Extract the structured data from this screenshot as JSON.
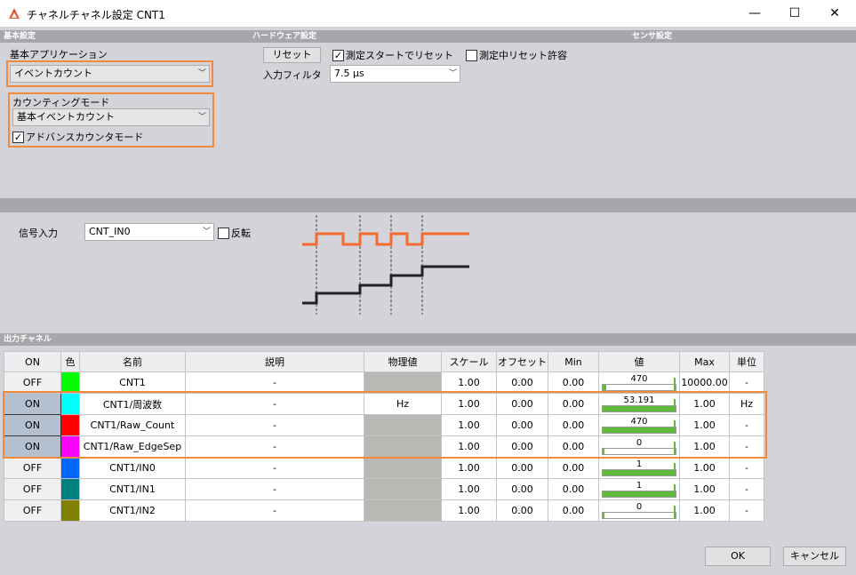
{
  "window": {
    "title": "チャネルチャネル設定 CNT1",
    "minimize": "—",
    "maximize": "☐",
    "close": "✕"
  },
  "sections": {
    "basic": "基本設定",
    "hardware": "ハードウェア設定",
    "sensor": "センサ設定",
    "output": "出力チャネル"
  },
  "basic": {
    "app_label": "基本アプリケーション",
    "app_value": "イベントカウント",
    "mode_label": "カウンティングモード",
    "mode_value": "基本イベントカウント",
    "advanced_label": "アドバンスカウンタモード",
    "advanced_checked": true
  },
  "hardware": {
    "reset_button": "リセット",
    "reset_on_start_label": "測定スタートでリセット",
    "reset_on_start_checked": true,
    "allow_reset_label": "測定中リセット許容",
    "allow_reset_checked": false,
    "filter_label": "入力フィルタ",
    "filter_value": "7.5 µs"
  },
  "signal": {
    "label": "信号入力",
    "value": "CNT_IN0",
    "invert_label": "反転",
    "invert_checked": false
  },
  "table": {
    "headers": [
      "ON",
      "色",
      "名前",
      "説明",
      "物理値",
      "スケール",
      "オフセット",
      "Min",
      "値",
      "Max",
      "単位"
    ],
    "rows": [
      {
        "on": "OFF",
        "color": "#00ff00",
        "name": "CNT1",
        "desc": "-",
        "phys": "",
        "scale": "1.00",
        "offset": "0.00",
        "min": "0.00",
        "value": "470",
        "fill": 0.05,
        "max": "10000.00",
        "unit": "-"
      },
      {
        "on": "ON",
        "color": "#00ffff",
        "name": "CNT1/周波数",
        "desc": "-",
        "phys": "Hz",
        "scale": "1.00",
        "offset": "0.00",
        "min": "0.00",
        "value": "53.191",
        "fill": 1.0,
        "max": "1.00",
        "unit": "Hz"
      },
      {
        "on": "ON",
        "color": "#ff0000",
        "name": "CNT1/Raw_Count",
        "desc": "-",
        "phys": "",
        "scale": "1.00",
        "offset": "0.00",
        "min": "0.00",
        "value": "470",
        "fill": 1.0,
        "max": "1.00",
        "unit": "-"
      },
      {
        "on": "ON",
        "color": "#ff00ff",
        "name": "CNT1/Raw_EdgeSep",
        "desc": "-",
        "phys": "",
        "scale": "1.00",
        "offset": "0.00",
        "min": "0.00",
        "value": "0",
        "fill": 0.0,
        "max": "1.00",
        "unit": "-"
      },
      {
        "on": "OFF",
        "color": "#0066ff",
        "name": "CNT1/IN0",
        "desc": "-",
        "phys": "",
        "scale": "1.00",
        "offset": "0.00",
        "min": "0.00",
        "value": "1",
        "fill": 1.0,
        "max": "1.00",
        "unit": "-"
      },
      {
        "on": "OFF",
        "color": "#008080",
        "name": "CNT1/IN1",
        "desc": "-",
        "phys": "",
        "scale": "1.00",
        "offset": "0.00",
        "min": "0.00",
        "value": "1",
        "fill": 1.0,
        "max": "1.00",
        "unit": "-"
      },
      {
        "on": "OFF",
        "color": "#808000",
        "name": "CNT1/IN2",
        "desc": "-",
        "phys": "",
        "scale": "1.00",
        "offset": "0.00",
        "min": "0.00",
        "value": "0",
        "fill": 0.0,
        "max": "1.00",
        "unit": "-"
      }
    ]
  },
  "footer": {
    "ok": "OK",
    "cancel": "キャンセル"
  },
  "colors": {
    "highlight": "#f08a3c",
    "signal": "#f26a2e",
    "counter": "#222222"
  }
}
